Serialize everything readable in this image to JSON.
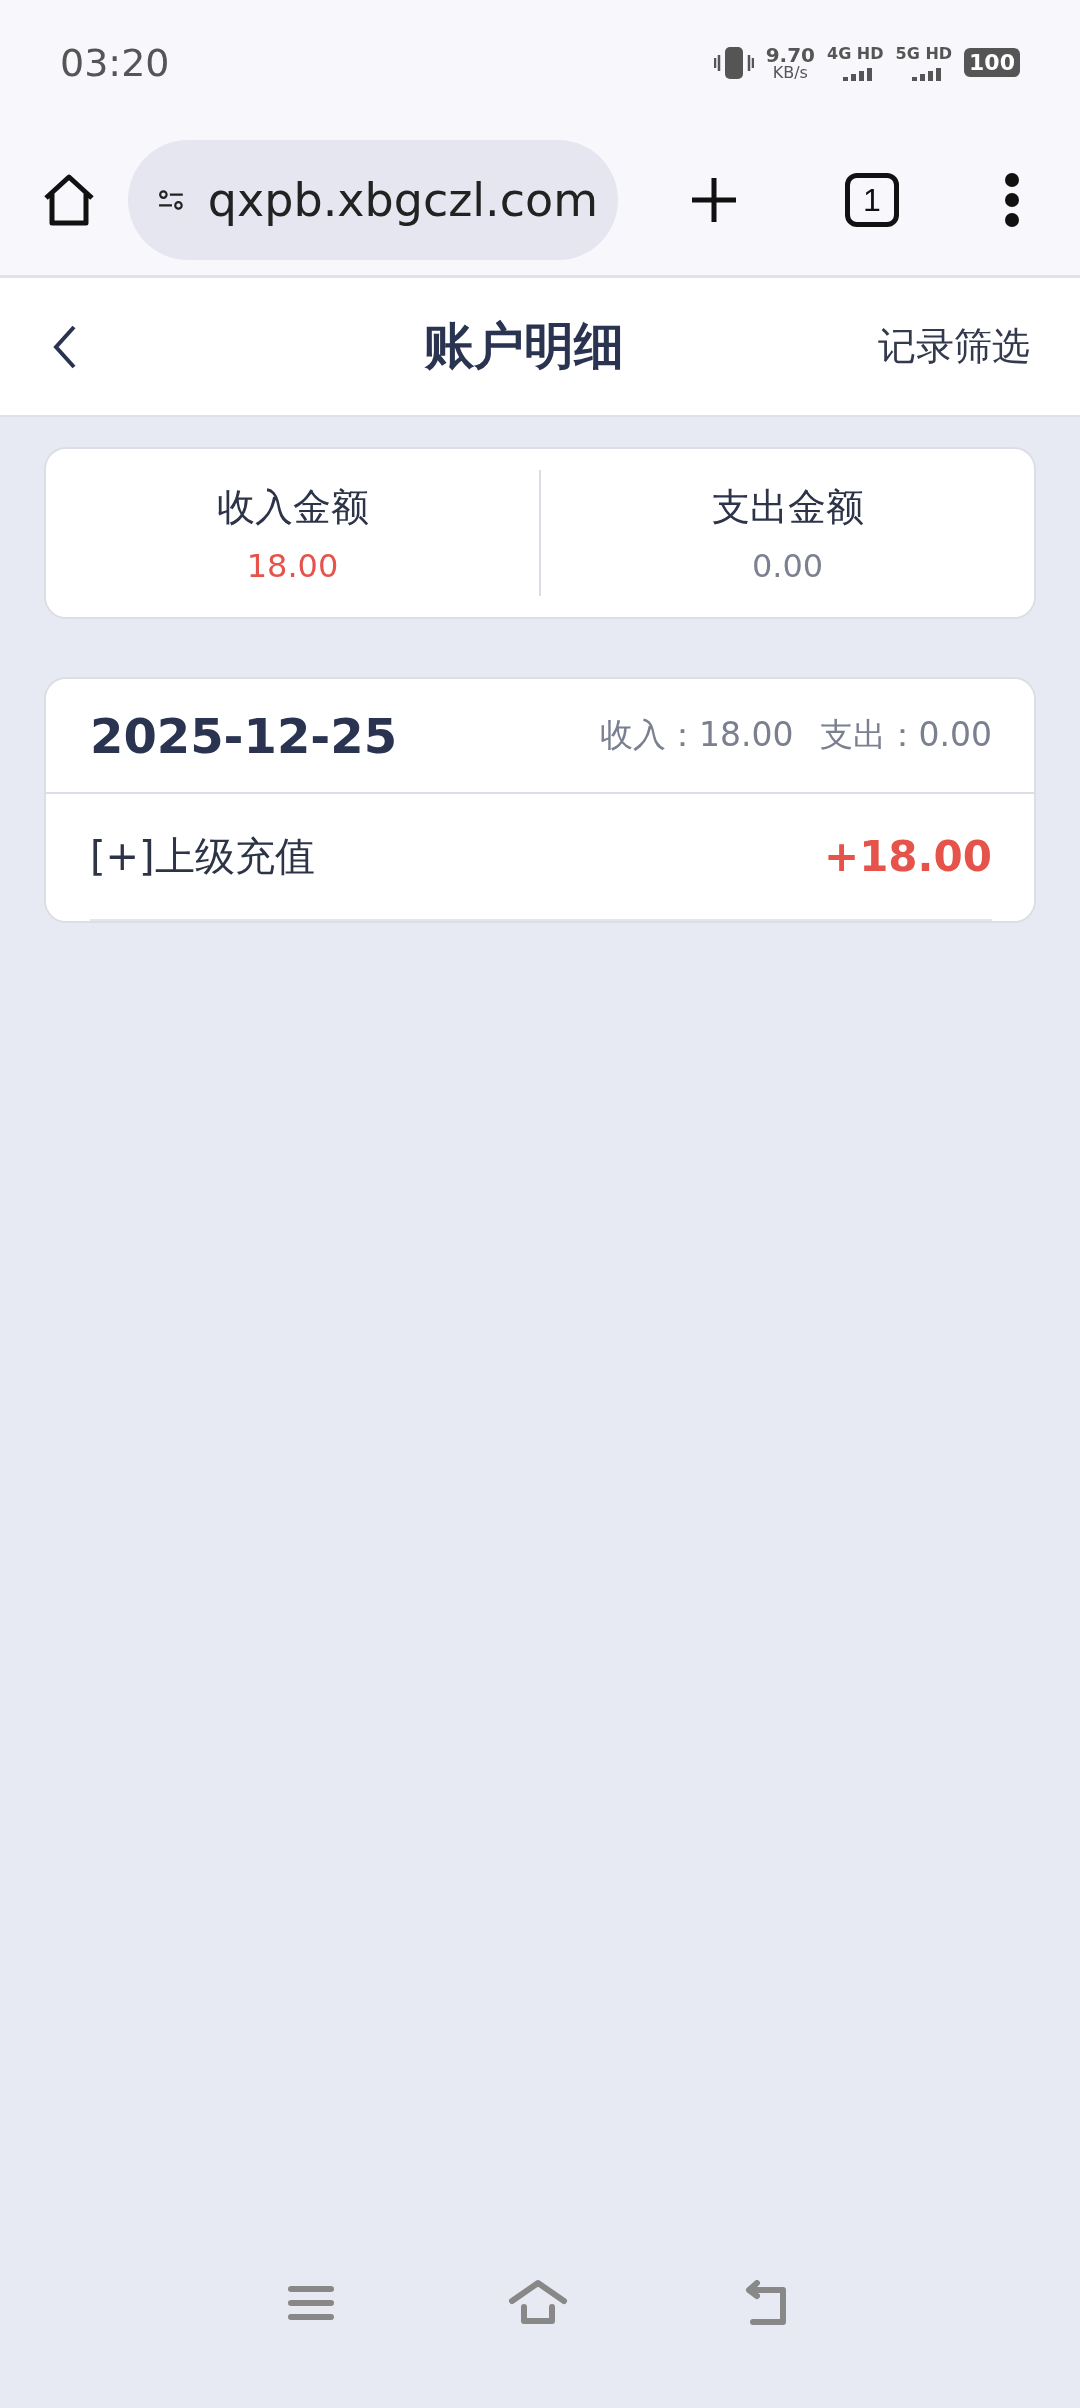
{
  "status_bar": {
    "time": "03:20",
    "net_speed": "9.70",
    "net_speed_unit": "KB/s",
    "networks": [
      "4G HD",
      "5G HD"
    ],
    "battery": "100"
  },
  "browser": {
    "url": "qxpb.xbgczl.com",
    "tab_count": "1"
  },
  "header": {
    "title": "账户明细",
    "action": "记录筛选"
  },
  "summary": [
    {
      "kind": "income",
      "label": "收入金额",
      "value": "18.00"
    },
    {
      "kind": "expense",
      "label": "支出金额",
      "value": "0.00"
    }
  ],
  "groups": [
    {
      "date": "2025-12-25",
      "income": "收入：18.00",
      "expense": "支出：0.00",
      "records": [
        {
          "kind": "income",
          "title": "[+]上级充值",
          "amount": "+18.00"
        }
      ]
    }
  ]
}
